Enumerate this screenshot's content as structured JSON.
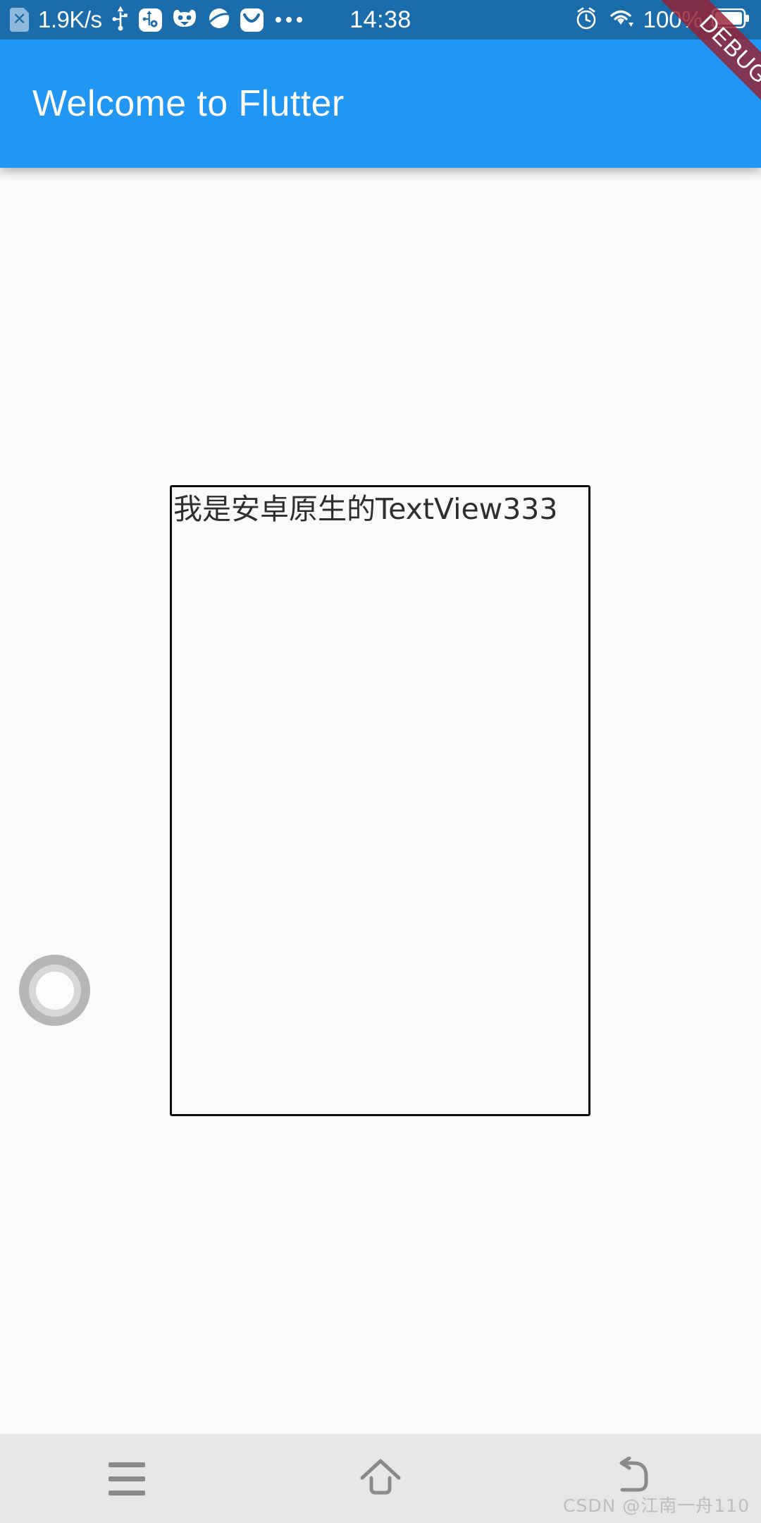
{
  "status_bar": {
    "network_speed": "1.9K/s",
    "time": "14:38",
    "battery_percent": "100%",
    "left_icons": [
      {
        "name": "sim-card-error-icon",
        "glyph": "✕"
      },
      {
        "name": "usb-icon"
      },
      {
        "name": "usb-debugging-icon"
      },
      {
        "name": "cat-face-app-icon"
      },
      {
        "name": "planet-browser-icon"
      },
      {
        "name": "smile-app-icon"
      },
      {
        "name": "more-dots-icon"
      }
    ],
    "right_icons": [
      {
        "name": "alarm-clock-icon"
      },
      {
        "name": "wifi-icon"
      },
      {
        "name": "battery-icon"
      }
    ],
    "bg_color": "#1b6cab",
    "fg_color": "#ffffff"
  },
  "debug_banner": {
    "label": "DEBUG",
    "color": "#992032"
  },
  "app_bar": {
    "title": "Welcome to Flutter",
    "bg_color": "#2196f3",
    "title_color": "#ffffff"
  },
  "content": {
    "native_view": {
      "text": "我是安卓原生的TextView333",
      "border_color": "#0d0d0d",
      "text_color": "#2e2e2e"
    },
    "assistive_touch": {
      "name": "assistive-touch-ball",
      "outer_color": "#b6b6b6",
      "mid_color": "#d7d7d7",
      "inner_color": "#fcfcfc"
    },
    "bg_color": "#fafafa"
  },
  "nav_bar": {
    "bg_color": "#e6e6e6",
    "icon_color": "#8a8a8a",
    "buttons": [
      {
        "name": "recents-button",
        "icon": "menu-icon"
      },
      {
        "name": "home-button",
        "icon": "home-icon"
      },
      {
        "name": "back-button",
        "icon": "back-arrow-icon"
      }
    ]
  },
  "watermark": {
    "text": "CSDN @江南一舟110"
  }
}
